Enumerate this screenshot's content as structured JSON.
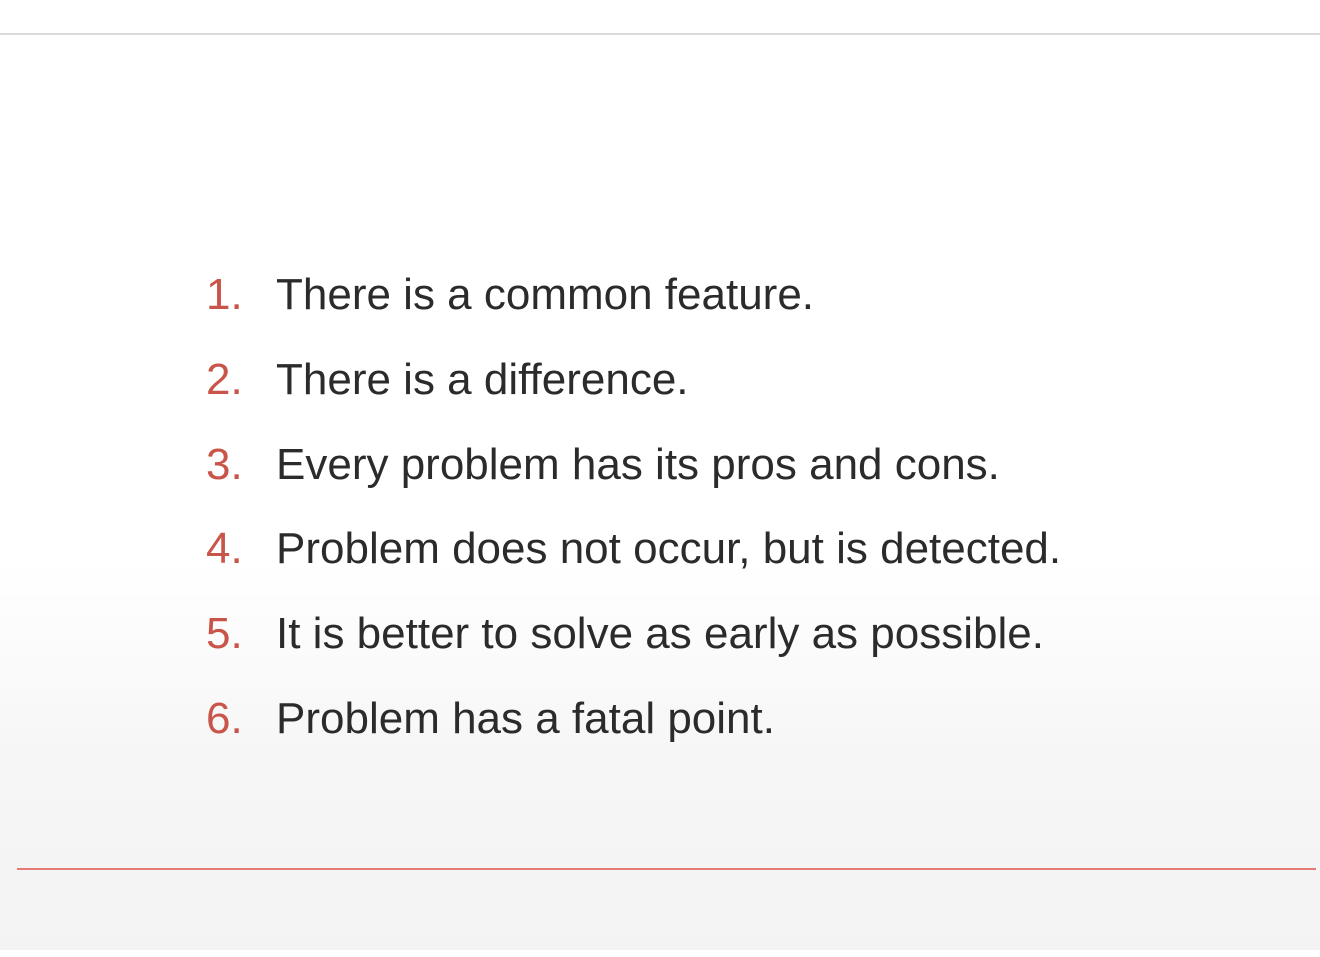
{
  "slide": {
    "items": [
      {
        "number": "1.",
        "text": "There is a common feature."
      },
      {
        "number": "2.",
        "text": "There is a difference."
      },
      {
        "number": "3.",
        "text": "Every problem has its pros and cons."
      },
      {
        "number": "4.",
        "text": "Problem does not occur, but is detected."
      },
      {
        "number": "5.",
        "text": "It is better to solve as early as possible."
      },
      {
        "number": "6.",
        "text": "Problem has a fatal point."
      }
    ]
  },
  "colors": {
    "number": "#c9554a",
    "text": "#2b2b2b",
    "top_rule": "#d9d9d9",
    "bottom_rule": "#e47b74"
  }
}
